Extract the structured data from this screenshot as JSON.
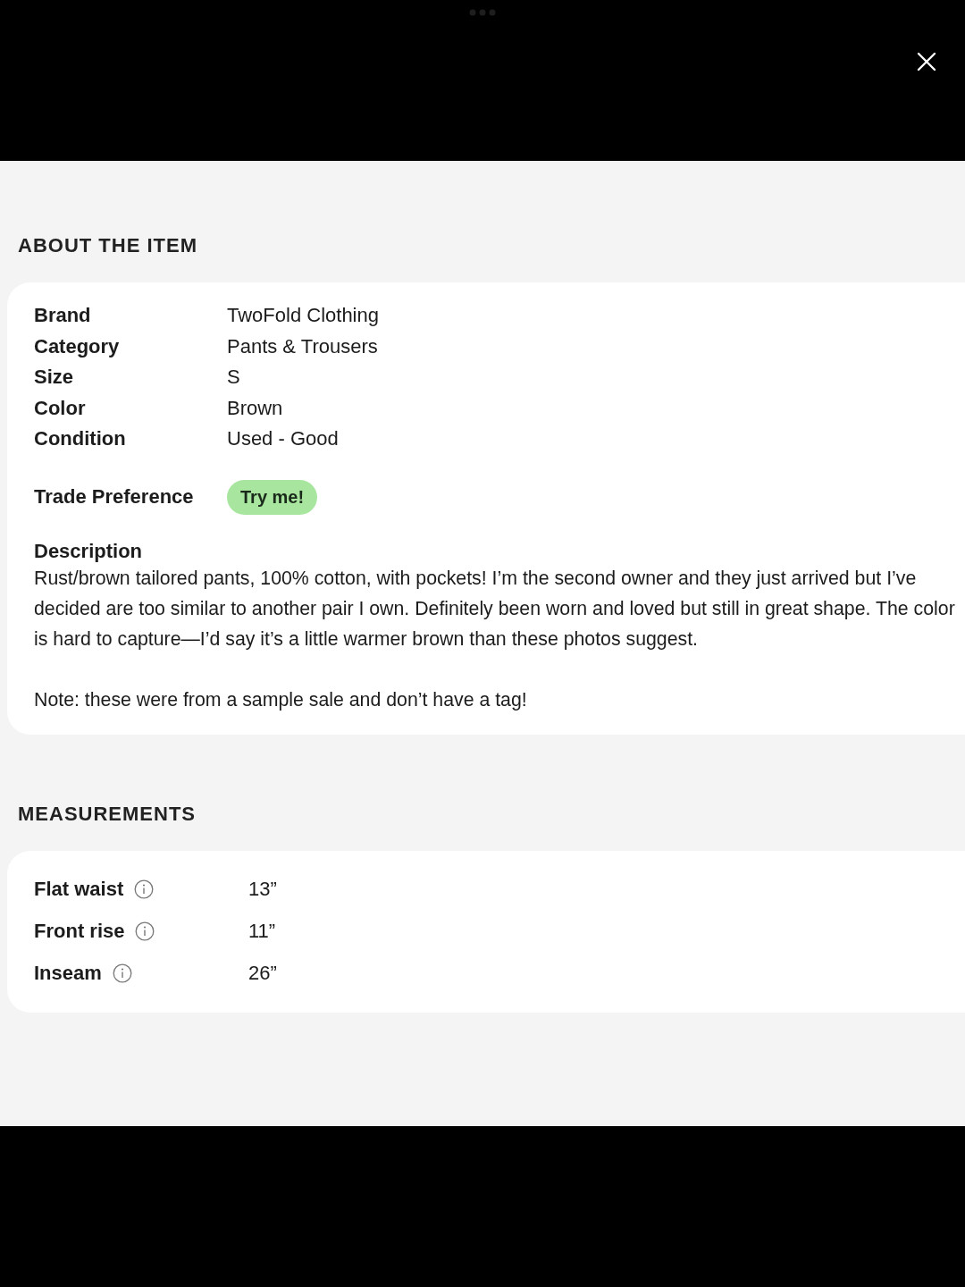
{
  "about": {
    "heading": "ABOUT THE ITEM",
    "details": [
      {
        "label": "Brand",
        "value": "TwoFold Clothing"
      },
      {
        "label": "Category",
        "value": "Pants & Trousers"
      },
      {
        "label": "Size",
        "value": "S"
      },
      {
        "label": "Color",
        "value": "Brown"
      },
      {
        "label": "Condition",
        "value": "Used - Good"
      }
    ],
    "trade_preference": {
      "label": "Trade Preference",
      "badge": "Try me!"
    },
    "description": {
      "label": "Description",
      "paragraphs": [
        "Rust/brown tailored pants, 100% cotton, with pockets! I’m the second owner and they just arrived but I’ve decided are too similar to another pair I own. Definitely been worn and loved but still in great shape. The color is hard to capture—I’d say it’s a little warmer brown than these photos suggest.",
        "Note: these were from a sample sale and don’t have a tag!"
      ]
    }
  },
  "measurements": {
    "heading": "MEASUREMENTS",
    "rows": [
      {
        "label": "Flat waist",
        "value": "13”"
      },
      {
        "label": "Front rise",
        "value": "11”"
      },
      {
        "label": "Inseam",
        "value": "26”"
      }
    ]
  }
}
